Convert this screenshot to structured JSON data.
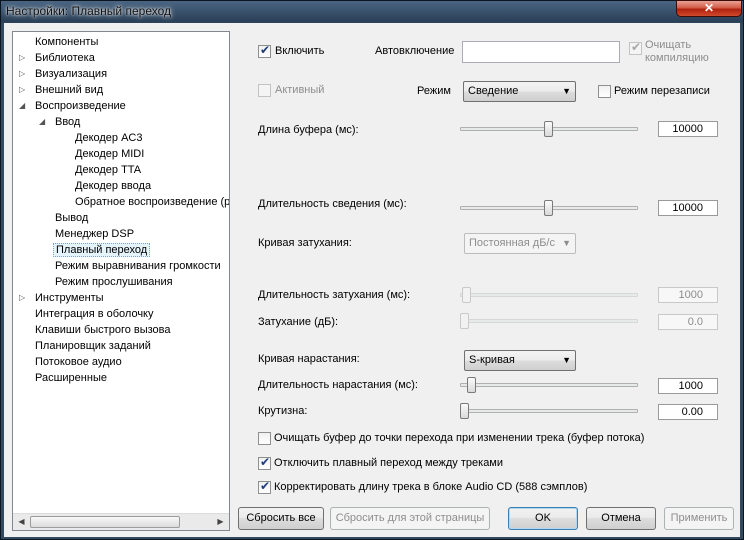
{
  "window": {
    "title": "Настройки: Плавный переход"
  },
  "tree": {
    "items": [
      {
        "label": "Компоненты"
      },
      {
        "label": "Библиотека"
      },
      {
        "label": "Визуализация"
      },
      {
        "label": "Внешний вид"
      },
      {
        "label": "Воспроизведение"
      },
      {
        "label": "Ввод"
      },
      {
        "label": "Декодер AC3"
      },
      {
        "label": "Декодер MIDI"
      },
      {
        "label": "Декодер TTA"
      },
      {
        "label": "Декодер ввода"
      },
      {
        "label": "Обратное воспроизведение (р"
      },
      {
        "label": "Вывод"
      },
      {
        "label": "Менеджер DSP"
      },
      {
        "label": "Плавный переход"
      },
      {
        "label": "Режим выравнивания громкости"
      },
      {
        "label": "Режим прослушивания"
      },
      {
        "label": "Инструменты"
      },
      {
        "label": "Интеграция в оболочку"
      },
      {
        "label": "Клавиши быстрого вызова"
      },
      {
        "label": "Планировщик заданий"
      },
      {
        "label": "Потоковое аудио"
      },
      {
        "label": "Расширенные"
      }
    ]
  },
  "settings": {
    "enable_label": "Включить",
    "enable_checked": true,
    "autoenable_label": "Автовключение",
    "autoenable_value": "",
    "clear_compilation_label1": "Очищать",
    "clear_compilation_label2": "компиляцию",
    "clear_compilation_checked": true,
    "active_label": "Активный",
    "active_checked": false,
    "mode_label": "Режим",
    "mode_value": "Сведение",
    "overwrite_label": "Режим перезаписи",
    "overwrite_checked": false,
    "buffer_label": "Длина буфера (мс):",
    "buffer_value": "10000",
    "mix_label": "Длительность сведения (мс):",
    "mix_value": "10000",
    "fade_curve_label": "Кривая затухания:",
    "fade_curve_value": "Постоянная дБ/с",
    "fade_duration_label": "Длительность затухания (мс):",
    "fade_duration_value": "1000",
    "fade_db_label": "Затухание (дБ):",
    "fade_db_value": "0.0",
    "rise_curve_label": "Кривая нарастания:",
    "rise_curve_value": "S-кривая",
    "rise_duration_label": "Длительность нарастания (мс):",
    "rise_duration_value": "1000",
    "steepness_label": "Крутизна:",
    "steepness_value": "0.00",
    "clear_buffer_label": "Очищать буфер до точки перехода при изменении трека (буфер потока)",
    "clear_buffer_checked": false,
    "disable_between_label": "Отключить плавный переход между треками",
    "disable_between_checked": true,
    "correct_cd_label": "Корректировать длину трека в блоке Audio CD (588 сэмплов)",
    "correct_cd_checked": true
  },
  "buttons": {
    "reset_all": "Сбросить все",
    "reset_page": "Сбросить для этой страницы",
    "ok": "OK",
    "cancel": "Отмена",
    "apply": "Применить"
  },
  "icons": {
    "close": "close-icon",
    "expand": "triangle-right-icon",
    "collapse": "triangle-down-icon"
  }
}
